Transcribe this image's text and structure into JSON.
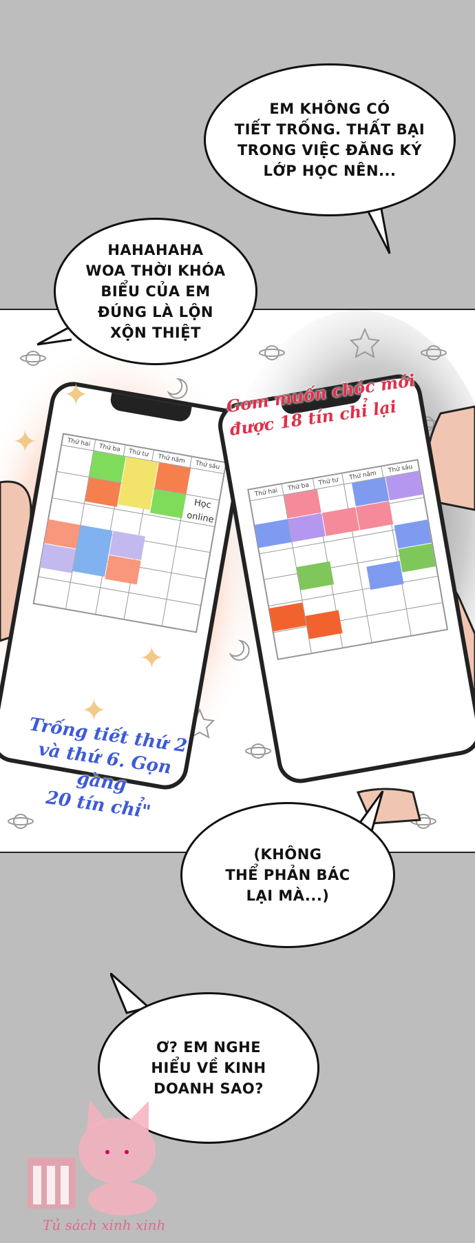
{
  "bubbles": {
    "b1": "EM KHÔNG CÓ\nTIẾT TRỐNG. THẤT BẠI\nTRONG VIỆC ĐĂNG KÝ\nLỚP HỌC NÊN...",
    "b2": "HAHAHAHA\nWOA THỜI KHÓA\nBIỂU CỦA EM\nĐÚNG LÀ LỘN\nXỘN THIỆT",
    "b3": "(KHÔNG\nTHỂ PHẢN BÁC\nLẠI MÀ...)",
    "b4": "Ơ? EM NGHE\nHIỂU VỀ KINH\nDOANH SAO?"
  },
  "left_phone": {
    "days": [
      "Thứ hai",
      "Thứ ba",
      "Thứ tư",
      "Thứ năm",
      "Thứ sáu"
    ],
    "note": "Học\nonline"
  },
  "right_phone": {
    "days": [
      "Thứ hai",
      "Thứ ba",
      "Thứ tư",
      "Thứ năm",
      "Thứ sáu"
    ]
  },
  "captions": {
    "blue": "Trống tiết thứ 2\nvà thứ 6. Gọn gàng\n20 tín chỉ\"",
    "red": "Gom muốn chóc mới\nđược 18 tín chỉ lại"
  },
  "watermark": "Tủ sách xinh xinh",
  "colors": {
    "background": "#bdbdbd",
    "caption_blue": "#3d5ad8",
    "caption_red": "#e0304a"
  }
}
